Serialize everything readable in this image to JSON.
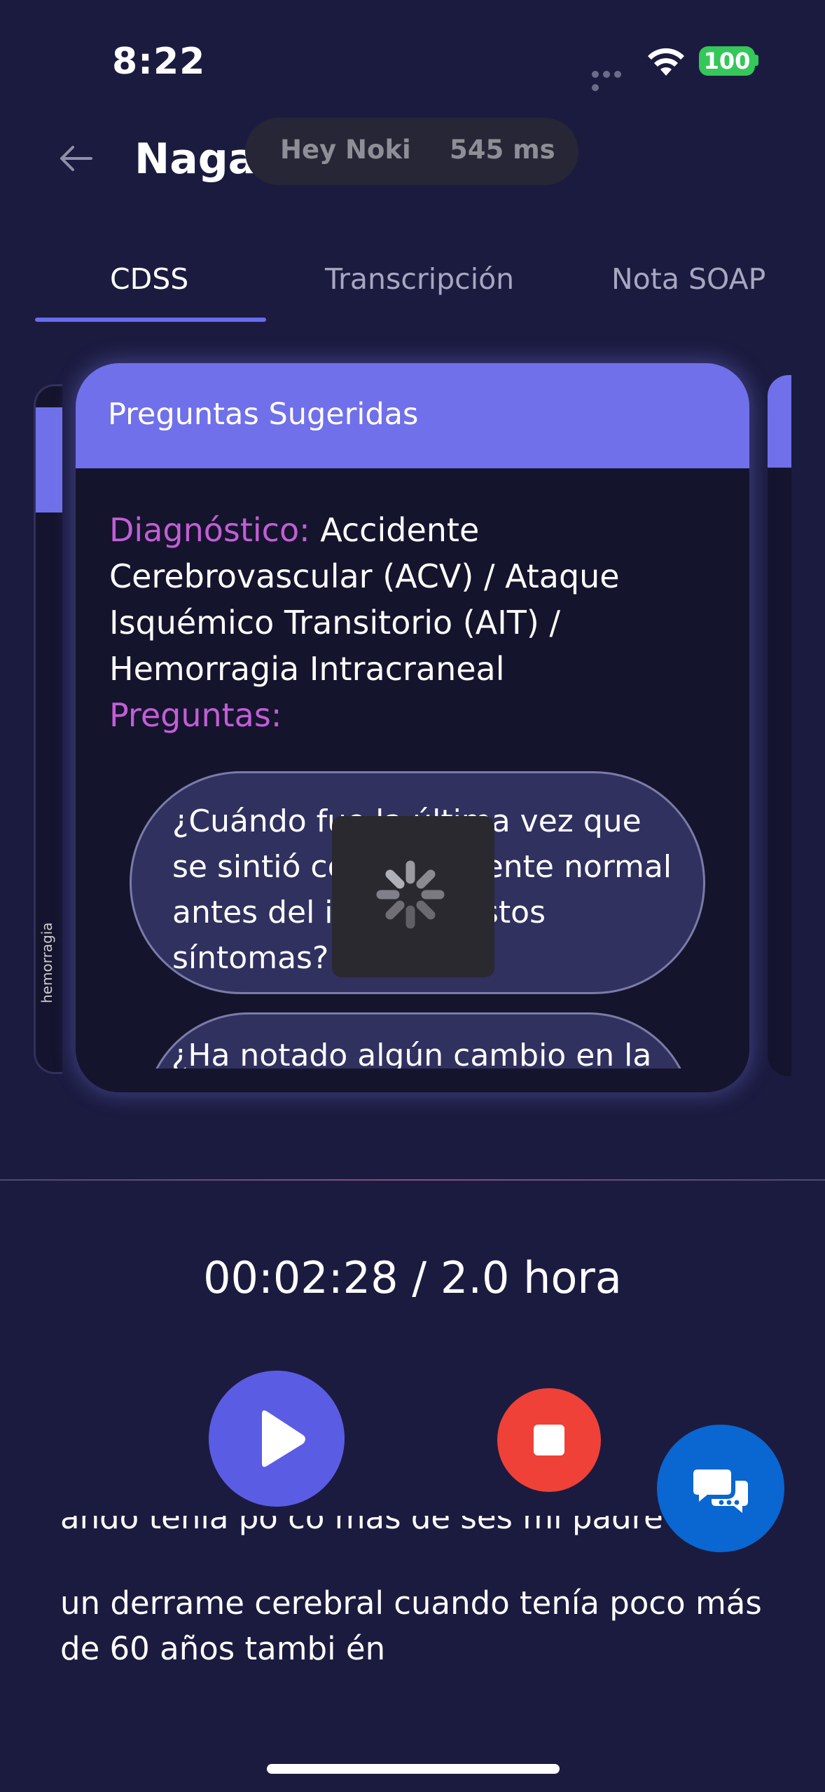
{
  "status_bar": {
    "time": "8:22",
    "battery": "100"
  },
  "header": {
    "title": "Naga",
    "pill": {
      "wake_word": "Hey Noki",
      "latency": "545 ms"
    }
  },
  "tabs": [
    {
      "label": "CDSS",
      "active": true
    },
    {
      "label": "Transcripción",
      "active": false
    },
    {
      "label": "Nota SOAP",
      "active": false
    }
  ],
  "card": {
    "title": "Preguntas Sugeridas",
    "diagnosis_label": "Diagnóstico:",
    "diagnosis_lines": [
      "Accidente",
      "Cerebrovascular (ACV) / Ataque",
      "Isquémico Transitorio (AIT) /",
      "Hemorragia Intracraneal"
    ],
    "questions_label": "Preguntas:",
    "questions": [
      "¿Cuándo fue la última vez que se sintió completamente normal antes del inicio de estos síntomas?",
      "¿Ha notado algún cambio en la"
    ]
  },
  "side_card_left_text": "hemorragia",
  "timer": {
    "elapsed": "00:02:28",
    "separator": "/",
    "limit": "2.0 hora"
  },
  "transcript": {
    "line_partial": "ando  tenía po co más  de ses mi padre sufrió",
    "line_1": "un derrame cerebral cuando tenía poco más",
    "line_2": "de 60 años  tambi én"
  },
  "colors": {
    "background": "#1b1b40",
    "accent": "#7070ea",
    "label_purple": "#c25ed6",
    "play": "#5b5ce4",
    "stop": "#ef4137",
    "chat": "#0a66d0"
  },
  "icons": {
    "back": "arrow-left-icon",
    "play": "play-icon",
    "stop": "stop-icon",
    "chat": "chat-bubbles-icon",
    "spinner": "spinner-icon"
  }
}
